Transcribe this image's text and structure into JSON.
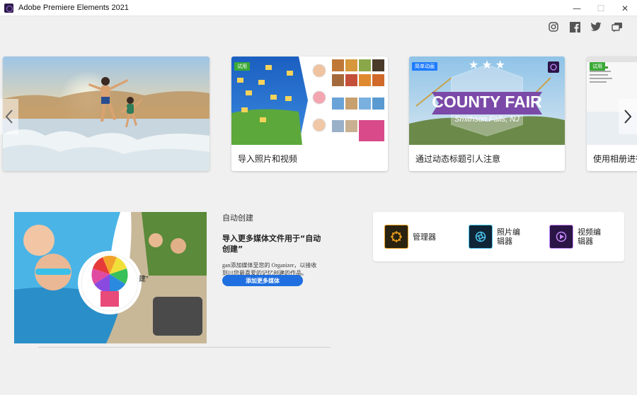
{
  "window": {
    "title": "Adobe Premiere Elements 2021"
  },
  "social": [
    "instagram-icon",
    "facebook-icon",
    "twitter-icon",
    "share-icon"
  ],
  "carousel": {
    "cards": [
      {
        "label": ""
      },
      {
        "label": "导入照片和视频",
        "badge": "试用"
      },
      {
        "label": "通过动态标题引人注意",
        "badge": "简单动画",
        "thumb_title": "COUNTY FAIR",
        "thumb_subtitle": "Smithson Falls, NJ"
      },
      {
        "label": "使用相册进行",
        "badge": "试用"
      }
    ]
  },
  "auto": {
    "label": "自动创建",
    "heading": "导入更多媒体文件用于“自动创建”",
    "desc": "gan添加媒体至您的 Organizer，以接收到川您最喜爱的记忆创建的作品。",
    "button": "添加更多媒体",
    "overlay": "建”"
  },
  "apps": [
    {
      "name": "管理器",
      "color": "#f0a21e",
      "bg": "#2a2311"
    },
    {
      "name": "照片编辑器",
      "color": "#4dc6f0",
      "bg": "#0f2536"
    },
    {
      "name": "视频编辑器",
      "color": "#c68cff",
      "bg": "#2b1446"
    }
  ]
}
